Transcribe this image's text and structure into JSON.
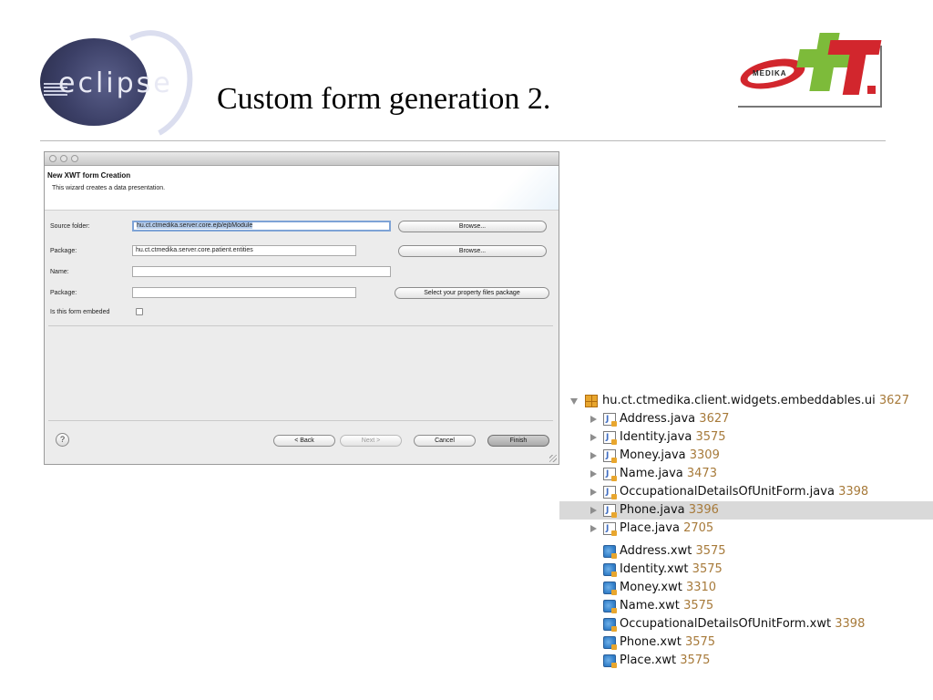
{
  "slide": {
    "title": "Custom form generation 2.",
    "logo_left_text": "eclipse",
    "logo_right_text": "MEDIKA"
  },
  "wizard": {
    "header_title": "New XWT form Creation",
    "header_description": "This wizard creates a data presentation.",
    "fields": {
      "source_folder_label": "Source folder:",
      "source_folder_value": "hu.ct.ctmedika.server.core.ejb/ejbModule",
      "package_label": "Package:",
      "package_value": "hu.ct.ctmedika.server.core.patient.entities",
      "name_label": "Name:",
      "name_value": "",
      "property_package_label": "Package:",
      "property_package_value": "",
      "embedded_label": "Is this form embeded"
    },
    "buttons": {
      "browse_source": "Browse...",
      "browse_package": "Browse...",
      "select_property_package": "Select your property  files package",
      "help": "?",
      "back": "< Back",
      "next": "Next >",
      "cancel": "Cancel",
      "finish": "Finish"
    }
  },
  "tree": {
    "root": {
      "name": "hu.ct.ctmedika.client.widgets.embeddables.ui",
      "revision": "3627"
    },
    "items": [
      {
        "name": "Address.java",
        "revision": "3627",
        "type": "java"
      },
      {
        "name": "Identity.java",
        "revision": "3575",
        "type": "java"
      },
      {
        "name": "Money.java",
        "revision": "3309",
        "type": "java"
      },
      {
        "name": "Name.java",
        "revision": "3473",
        "type": "java"
      },
      {
        "name": "OccupationalDetailsOfUnitForm.java",
        "revision": "3398",
        "type": "java"
      },
      {
        "name": "Phone.java",
        "revision": "3396",
        "type": "java",
        "selected": true
      },
      {
        "name": "Place.java",
        "revision": "2705",
        "type": "java"
      },
      {
        "name": "Address.xwt",
        "revision": "3575",
        "type": "xwt"
      },
      {
        "name": "Identity.xwt",
        "revision": "3575",
        "type": "xwt"
      },
      {
        "name": "Money.xwt",
        "revision": "3310",
        "type": "xwt"
      },
      {
        "name": "Name.xwt",
        "revision": "3575",
        "type": "xwt"
      },
      {
        "name": "OccupationalDetailsOfUnitForm.xwt",
        "revision": "3398",
        "type": "xwt"
      },
      {
        "name": "Phone.xwt",
        "revision": "3575",
        "type": "xwt"
      },
      {
        "name": "Place.xwt",
        "revision": "3575",
        "type": "xwt"
      }
    ]
  },
  "colors": {
    "selection": "#d9d9d9",
    "revision": "#a77a3a",
    "focus_border": "#7ea3d6",
    "brand_red": "#d2262d",
    "brand_green": "#7dbb3a"
  }
}
